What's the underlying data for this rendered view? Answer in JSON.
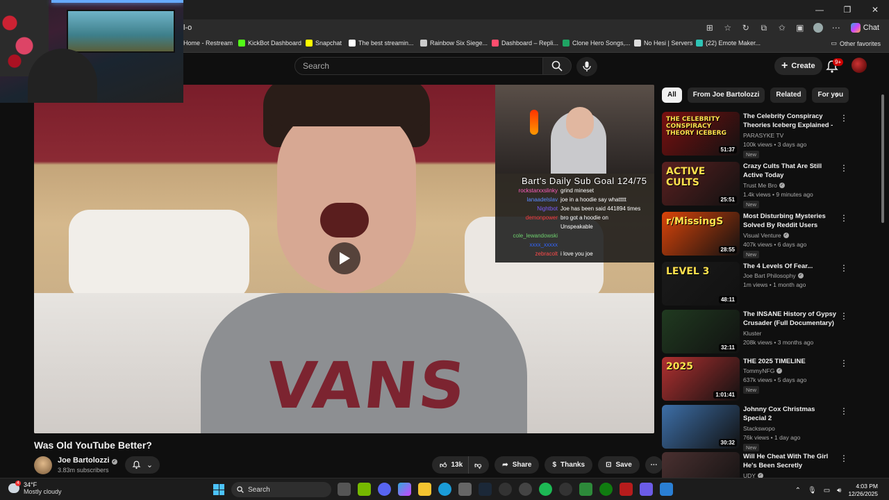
{
  "browser": {
    "url": "l-o",
    "chat_label": "Chat",
    "bookmarks": [
      {
        "label": "Home - Restream",
        "color": "#4aa3ff"
      },
      {
        "label": "KickBot Dashboard",
        "color": "#53fc18"
      },
      {
        "label": "Snapchat",
        "color": "#fffc00"
      },
      {
        "label": "The best streamin...",
        "color": "#ffffff"
      },
      {
        "label": "Rainbow Six Siege...",
        "color": "#cccccc"
      },
      {
        "label": "Dashboard – Repli...",
        "color": "#ff4d6d"
      },
      {
        "label": "Clone Hero Songs,...",
        "color": "#1fa463"
      },
      {
        "label": "No Hesi | Servers",
        "color": "#dddddd"
      },
      {
        "label": "(22) Emote Maker...",
        "color": "#2ec4b6"
      }
    ],
    "other_favorites": "Other favorites"
  },
  "header": {
    "search_placeholder": "Search",
    "create_label": "Create",
    "notification_count": "9+"
  },
  "video": {
    "title": "Was Old YouTube Better?",
    "shirt_text": "VANS",
    "overlay": {
      "sub_goal": "Bart's Daily Sub Goal 124/75",
      "chat": [
        {
          "user": "rockstarxxslinky",
          "msg": "grind mineset",
          "color": "#ff5fbf"
        },
        {
          "user": "lanaadelslav",
          "msg": "joe in a hoodie say whattttt",
          "color": "#5b8cff"
        },
        {
          "user": "Nightbot",
          "msg": "Joe has been said 441894 times",
          "color": "#7a5cff"
        },
        {
          "user": "demonpower",
          "msg": "bro got a hoodie on",
          "color": "#ff3b3b"
        },
        {
          "user": "",
          "msg": "Unspeakable",
          "color": "#ffffff"
        },
        {
          "user": "cole_lewandowski",
          "msg": "",
          "color": "#6fd06f"
        },
        {
          "user": "xxxx_xxxxx",
          "msg": "",
          "color": "#3366ff"
        },
        {
          "user": "zebracolt",
          "msg": "i love you joe",
          "color": "#ff4a4a"
        }
      ]
    }
  },
  "channel": {
    "name": "Joe Bartolozzi",
    "subscribers": "3.83m subscribers"
  },
  "actions": {
    "likes": "13k",
    "share": "Share",
    "thanks": "Thanks",
    "save": "Save"
  },
  "sidebar": {
    "chips": [
      "All",
      "From Joe Bartolozzi",
      "Related",
      "For you"
    ],
    "recommendations": [
      {
        "title": "The Celebrity Conspiracy Theories Iceberg Explained - ...",
        "channel": "PARASYKE TV",
        "verified": false,
        "meta": "100k views • 3 days ago",
        "badge": "New",
        "duration": "51:37",
        "thumb_text": "THE CELEBRITY CONSPIRACY THEORY ICEBERG",
        "thumb_color": "#7a1010"
      },
      {
        "title": "Crazy Cults That Are Still Active Today",
        "channel": "Trust Me Bro",
        "verified": true,
        "meta": "1.4k views • 9 minutes ago",
        "badge": "New",
        "duration": "25:51",
        "thumb_text": "ACTIVE CULTS",
        "thumb_color": "#5a2020"
      },
      {
        "title": "Most Disturbing Mysteries Solved By Reddit Users",
        "channel": "Visual Venture",
        "verified": true,
        "meta": "407k views • 6 days ago",
        "badge": "New",
        "duration": "28:55",
        "thumb_text": "r/MissingS",
        "thumb_color": "#d9440a"
      },
      {
        "title": "The 4 Levels Of Fear...",
        "channel": "Joe Bart Philosophy",
        "verified": true,
        "meta": "1m views • 1 month ago",
        "badge": "",
        "duration": "48:11",
        "thumb_text": "LEVEL 3",
        "thumb_color": "#1a1a1a"
      },
      {
        "title": "The INSANE History of Gypsy Crusader (Full Documentary)",
        "channel": "Kluster",
        "verified": false,
        "meta": "208k views • 3 months ago",
        "badge": "",
        "duration": "32:11",
        "thumb_text": "",
        "thumb_color": "#203a20"
      },
      {
        "title": "THE 2025 TIMELINE",
        "channel": "TommyNFG",
        "verified": true,
        "meta": "637k views • 5 days ago",
        "badge": "New",
        "duration": "1:01:41",
        "thumb_text": "2025",
        "thumb_color": "#b03030"
      },
      {
        "title": "Johnny Cox Christmas Special 2",
        "channel": "Stackswopo",
        "verified": false,
        "meta": "76k views • 1 day ago",
        "badge": "New",
        "duration": "30:32",
        "thumb_text": "",
        "thumb_color": "#3d6fa8"
      },
      {
        "title": "Will He Cheat With The Girl He's Been Secretly Messaging? | U...",
        "channel": "UDY",
        "verified": true,
        "meta": "",
        "badge": "",
        "duration": "",
        "thumb_text": "",
        "thumb_color": "#4a3030"
      }
    ]
  },
  "taskbar": {
    "temperature": "34°F",
    "condition": "Mostly cloudy",
    "search_label": "Search",
    "time": "4:03 PM",
    "date": "12/26/2025"
  }
}
